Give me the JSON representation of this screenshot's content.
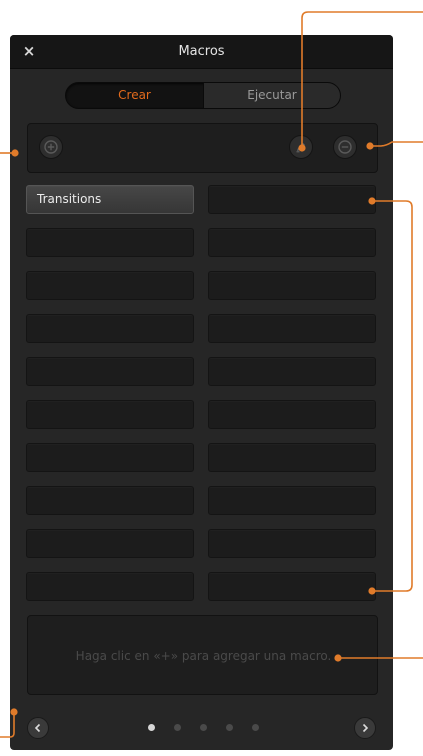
{
  "window": {
    "title": "Macros",
    "close_glyph": "×"
  },
  "tabs": [
    {
      "label": "Crear",
      "selected": true
    },
    {
      "label": "Ejecutar",
      "selected": false
    }
  ],
  "toolbar": {
    "add_icon": "plus-circle-icon",
    "edit_icon": "pencil-icon",
    "remove_icon": "minus-circle-icon"
  },
  "macros": {
    "slots": [
      "Transitions",
      "",
      "",
      "",
      "",
      "",
      "",
      "",
      "",
      "",
      "",
      "",
      "",
      "",
      "",
      "",
      "",
      "",
      "",
      ""
    ]
  },
  "description": {
    "placeholder": "Haga clic en «+» para agregar una macro."
  },
  "pager": {
    "pages": 5,
    "current": 1,
    "prev_icon": "chevron-left-icon",
    "next_icon": "chevron-right-icon"
  },
  "colors": {
    "accent": "#e26a1c",
    "panel": "#262626",
    "callout": "#e07b2a"
  }
}
